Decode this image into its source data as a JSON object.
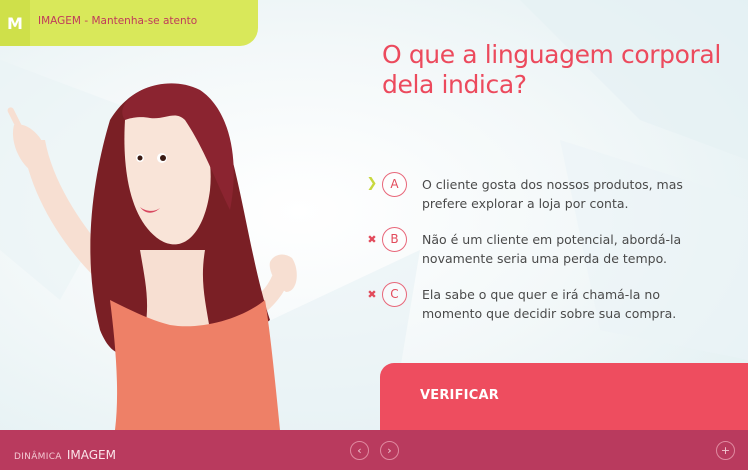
{
  "header": {
    "logo": "M",
    "title": "IMAGEM - Mantenha-se atento"
  },
  "question": {
    "line1": "O que a linguagem corporal",
    "line2": "dela indica?"
  },
  "options": [
    {
      "letter": "A",
      "mark": "correct",
      "mark_icon": "chevron-right-icon",
      "line1": "O cliente gosta dos nossos produtos, mas",
      "line2": "prefere explorar a loja por conta."
    },
    {
      "letter": "B",
      "mark": "wrong",
      "mark_icon": "x-icon",
      "line1": "Não é um cliente em potencial, abordá-la",
      "line2": "novamente seria uma perda de tempo."
    },
    {
      "letter": "C",
      "mark": "wrong",
      "mark_icon": "x-icon",
      "line1": "Ela sabe o que quer e irá chamá-la no",
      "line2": "momento que decidir sobre sua compra."
    }
  ],
  "verify_label": "VERIFICAR",
  "footer": {
    "brand_small": "DINÂMICA",
    "brand_big": "IMAGEM",
    "prev_icon": "‹",
    "next_icon": "›",
    "plus_icon": "+"
  },
  "colors": {
    "accent": "#ee4d5f",
    "lime": "#d9e85a",
    "footer": "#b93a5e",
    "correct_mark": "#c8d83e",
    "wrong_mark": "#e24a5b"
  }
}
